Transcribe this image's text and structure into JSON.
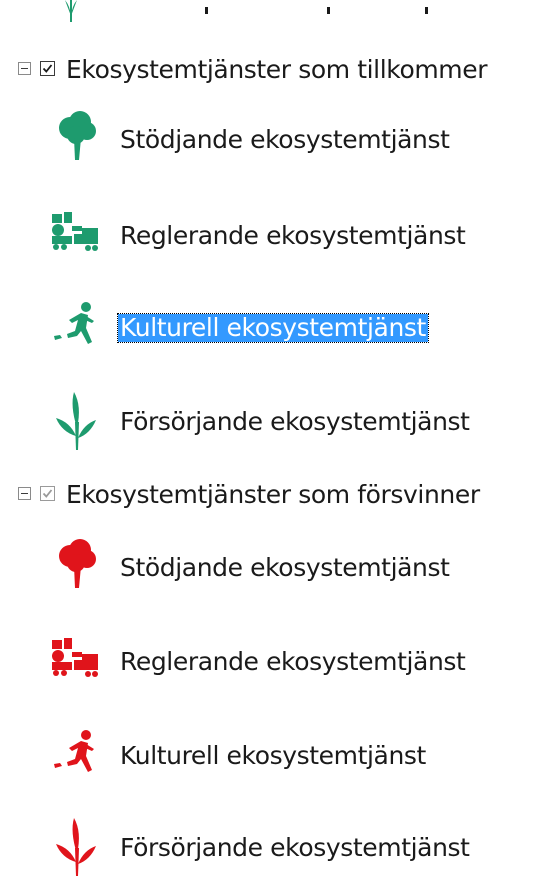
{
  "colors": {
    "added": "#1e9b6e",
    "removed": "#e0141b",
    "selection": "#3399ff"
  },
  "groups": [
    {
      "label": "Ekosystemtjänster som tillkommer",
      "checked": true,
      "expanded": true,
      "items": [
        {
          "label": "Stödjande ekosystemtjänst",
          "icon": "tree-icon"
        },
        {
          "label": "Reglerande ekosystemtjänst",
          "icon": "regulating-icon"
        },
        {
          "label": "Kulturell ekosystemtjänst",
          "icon": "runner-icon",
          "selected": true
        },
        {
          "label": "Försörjande ekosystemtjänst",
          "icon": "wheat-icon"
        }
      ]
    },
    {
      "label": "Ekosystemtjänster som försvinner",
      "checked": true,
      "expanded": true,
      "items": [
        {
          "label": "Stödjande ekosystemtjänst",
          "icon": "tree-icon"
        },
        {
          "label": "Reglerande ekosystemtjänst",
          "icon": "regulating-icon"
        },
        {
          "label": "Kulturell ekosystemtjänst",
          "icon": "runner-icon"
        },
        {
          "label": "Försörjande ekosystemtjänst",
          "icon": "wheat-icon"
        }
      ]
    }
  ]
}
